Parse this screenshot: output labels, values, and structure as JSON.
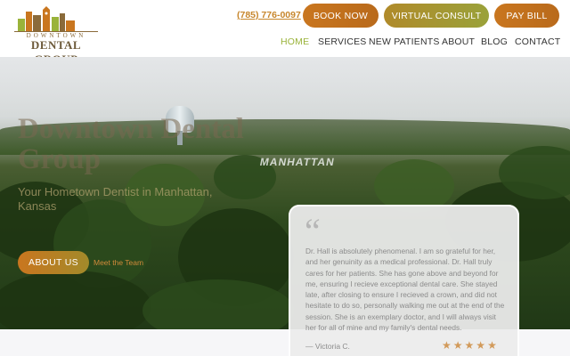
{
  "header": {
    "logo": {
      "line1": "DOWNTOWN",
      "line2": "DENTAL GROUP"
    },
    "phone": "(785) 776-0097",
    "buttons": {
      "book": "BOOK NOW",
      "virtual": "VIRTUAL CONSULT",
      "pay": "PAY BILL"
    },
    "nav": [
      {
        "label": "HOME",
        "active": true
      },
      {
        "label": "SERVICES"
      },
      {
        "label": "NEW PATIENTS"
      },
      {
        "label": "ABOUT"
      },
      {
        "label": "BLOG"
      },
      {
        "label": "CONTACT"
      }
    ]
  },
  "hero": {
    "title": "Downtown Dental Group",
    "subtitle": "Your Hometown Dentist in Manhattan, Kansas",
    "hill_sign": "MANHATTAN",
    "about_button": "ABOUT US",
    "meet_link": "Meet the Team"
  },
  "testimonial": {
    "quote_mark": "“",
    "text": "Dr. Hall is absolutely phenomenal. I am so grateful for her, and her genuinity as a medical professional. Dr. Hall truly cares for her patients. She has gone above and beyond for me, ensuring I recieve exceptional dental care. She stayed late, after closing to ensure I recieved a crown, and did not hesitate to do so, personally walking me out at the end of the session. She is an exemplary doctor, and I will always visit her for all of mine and my family's dental needs.",
    "author": "— Victoria C.",
    "rating": 5,
    "star_glyph": "★"
  },
  "colors": {
    "accent_orange": "#c9761f",
    "accent_green": "#9ab33a",
    "nav_active": "#9ab33a"
  }
}
